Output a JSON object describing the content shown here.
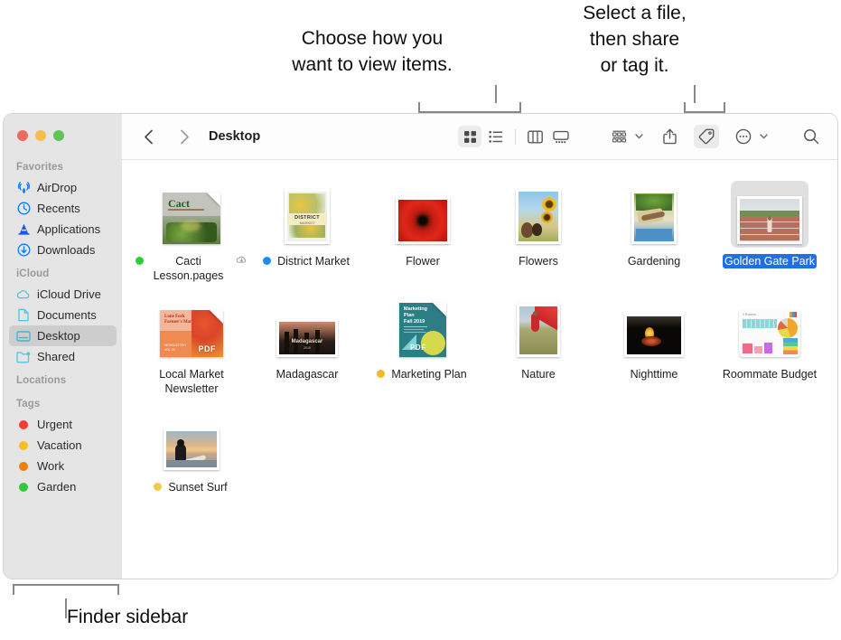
{
  "callouts": {
    "view": "Choose how you\nwant to view items.",
    "share": "Select a file,\nthen share\nor tag it.",
    "sidebar": "Finder sidebar"
  },
  "window": {
    "traffic_lights": [
      {
        "name": "close-button",
        "color": "#ED6A5E"
      },
      {
        "name": "minimize-button",
        "color": "#F5BD4F"
      },
      {
        "name": "zoom-button",
        "color": "#61C454"
      }
    ]
  },
  "toolbar": {
    "back_icon": "chevron-left-icon",
    "forward_icon": "chevron-right-icon",
    "path_title": "Desktop",
    "view_buttons": [
      {
        "icon": "icon-view-icon",
        "label": "Icon view",
        "active": true
      },
      {
        "icon": "list-view-icon",
        "label": "List view",
        "active": false
      },
      {
        "icon": "column-view-icon",
        "label": "Column view",
        "active": false
      },
      {
        "icon": "gallery-view-icon",
        "label": "Gallery view",
        "active": false
      }
    ],
    "action_buttons": [
      {
        "icon": "group-by-icon",
        "label": "Group items",
        "active": false,
        "chevron": true
      },
      {
        "icon": "share-icon",
        "label": "Share",
        "active": false,
        "chevron": false
      },
      {
        "icon": "tag-icon",
        "label": "Tags",
        "active": true,
        "chevron": false
      },
      {
        "icon": "more-icon",
        "label": "More",
        "active": false,
        "chevron": true
      }
    ],
    "search_icon": "search-icon",
    "accent_selected_bg": "#ececec"
  },
  "sidebar": {
    "sections": [
      {
        "header": "Favorites",
        "items": [
          {
            "label": "AirDrop",
            "icon": "airdrop-icon",
            "color": "#0a7aff",
            "selected": false
          },
          {
            "label": "Recents",
            "icon": "clock-icon",
            "color": "#0a7aff",
            "selected": false
          },
          {
            "label": "Applications",
            "icon": "app-store-icon",
            "color": "#1a56f0",
            "selected": false
          },
          {
            "label": "Downloads",
            "icon": "download-icon",
            "color": "#0a7aff",
            "selected": false
          }
        ]
      },
      {
        "header": "iCloud",
        "items": [
          {
            "label": "iCloud Drive",
            "icon": "cloud-icon",
            "color": "#4cc8e0",
            "selected": false
          },
          {
            "label": "Documents",
            "icon": "document-icon",
            "color": "#4cc8e0",
            "selected": false
          },
          {
            "label": "Desktop",
            "icon": "desktop-icon",
            "color": "#3ab8d4",
            "selected": true
          },
          {
            "label": "Shared",
            "icon": "shared-folder-icon",
            "color": "#4cc8e0",
            "selected": false
          }
        ]
      },
      {
        "header": "Locations",
        "items": []
      },
      {
        "header": "Tags",
        "items": [
          {
            "label": "Urgent",
            "icon": "tag-dot-icon",
            "color": "#fb3b30",
            "selected": false
          },
          {
            "label": "Vacation",
            "icon": "tag-dot-icon",
            "color": "#f5c021",
            "selected": false
          },
          {
            "label": "Work",
            "icon": "tag-dot-icon",
            "color": "#ef7f0a",
            "selected": false
          },
          {
            "label": "Garden",
            "icon": "tag-dot-icon",
            "color": "#2ecb36",
            "selected": false
          }
        ]
      }
    ],
    "background": "#e5e5e5",
    "selected_background": "#cdcdcd"
  },
  "files": [
    {
      "name": "Cacti Lesson.pages",
      "thumb": "pages-doc-cacti",
      "tag_dot": "#2ecb36",
      "cloud_badge": true,
      "selected": false
    },
    {
      "name": "District Market",
      "thumb": "photo-district-market",
      "tag_dot": "#1e8bf0",
      "cloud_badge": false,
      "selected": false
    },
    {
      "name": "Flower",
      "thumb": "photo-flower-red",
      "tag_dot": null,
      "cloud_badge": false,
      "selected": false
    },
    {
      "name": "Flowers",
      "thumb": "photo-sunflowers",
      "tag_dot": null,
      "cloud_badge": false,
      "selected": false
    },
    {
      "name": "Gardening",
      "thumb": "photo-gardening",
      "tag_dot": null,
      "cloud_badge": false,
      "selected": false
    },
    {
      "name": "Golden Gate Park",
      "thumb": "photo-golden-gate-park",
      "tag_dot": null,
      "cloud_badge": false,
      "selected": true
    },
    {
      "name": "Local Market Newsletter",
      "thumb": "pdf-local-market",
      "tag_dot": null,
      "cloud_badge": false,
      "selected": false
    },
    {
      "name": "Madagascar",
      "thumb": "photo-madagascar",
      "tag_dot": null,
      "cloud_badge": false,
      "selected": false
    },
    {
      "name": "Marketing Plan",
      "thumb": "pdf-marketing-plan",
      "tag_dot": "#f5b828",
      "cloud_badge": false,
      "selected": false
    },
    {
      "name": "Nature",
      "thumb": "photo-nature",
      "tag_dot": null,
      "cloud_badge": false,
      "selected": false
    },
    {
      "name": "Nighttime",
      "thumb": "photo-nighttime",
      "tag_dot": null,
      "cloud_badge": false,
      "selected": false
    },
    {
      "name": "Roommate Budget",
      "thumb": "numbers-roommate-budget",
      "tag_dot": null,
      "cloud_badge": false,
      "selected": false
    },
    {
      "name": "Sunset Surf",
      "thumb": "photo-sunset-surf",
      "tag_dot": "#f5c84a",
      "cloud_badge": false,
      "selected": false
    }
  ]
}
